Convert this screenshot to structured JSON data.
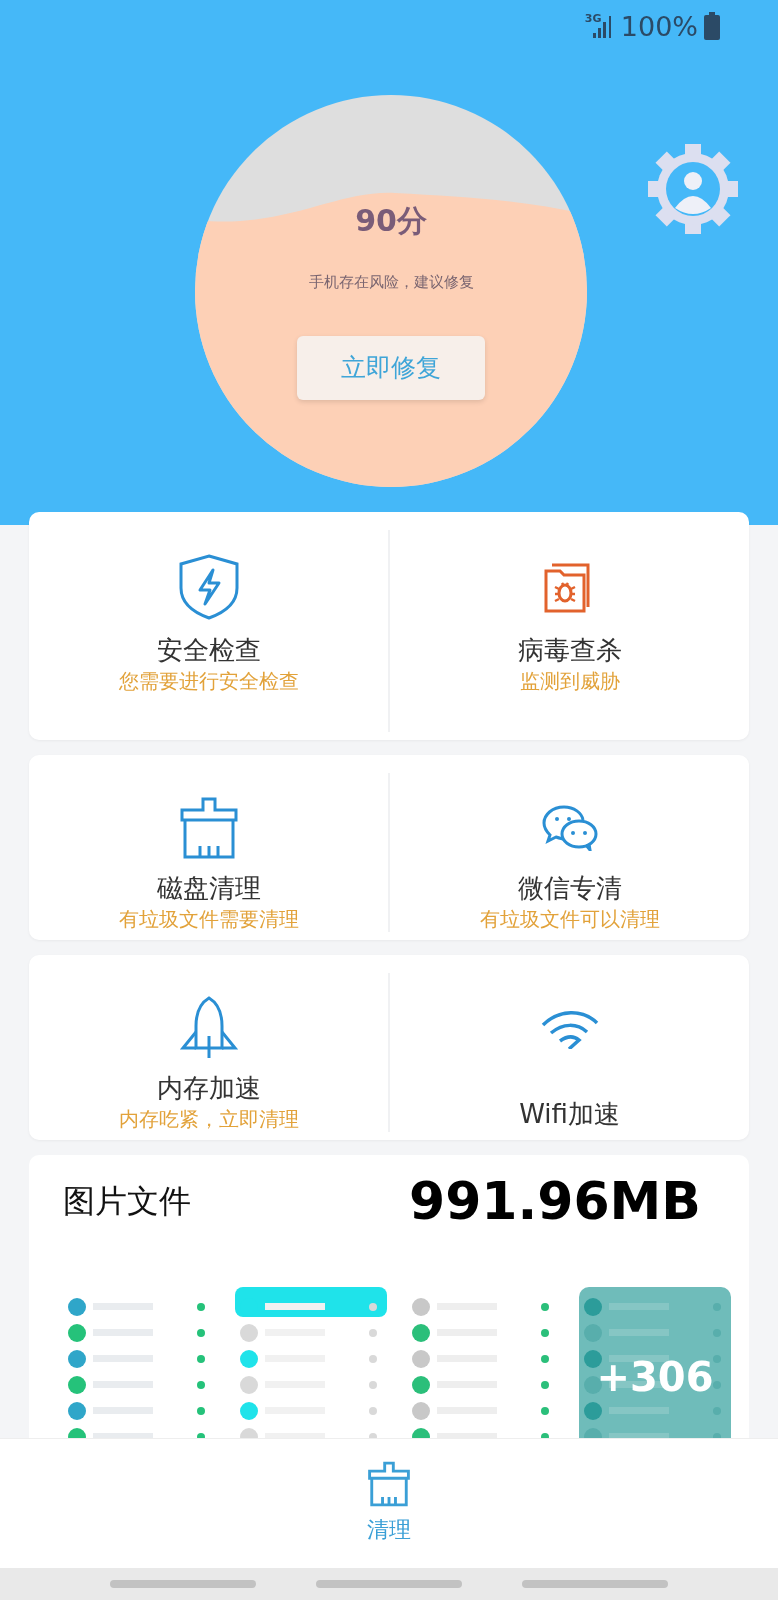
{
  "status_bar": {
    "network": "3G",
    "battery": "100%"
  },
  "gauge": {
    "score": "90分",
    "message": "手机存在风险，建议修复",
    "button": "立即修复"
  },
  "features": [
    {
      "title": "安全检查",
      "subtitle": "您需要进行安全检查"
    },
    {
      "title": "病毒查杀",
      "subtitle": "监测到威胁"
    },
    {
      "title": "磁盘清理",
      "subtitle": "有垃圾文件需要清理"
    },
    {
      "title": "微信专清",
      "subtitle": "有垃圾文件可以清理"
    },
    {
      "title": "内存加速",
      "subtitle": "内存吃紧，立即清理"
    },
    {
      "title": "Wifi加速"
    }
  ],
  "photos": {
    "title": "图片文件",
    "size": "991.96MB",
    "thumbnails": [
      {
        "kind": "picture"
      },
      {
        "kind": "picture"
      },
      {
        "kind": "picture"
      },
      {
        "kind": "picture",
        "more": "+306"
      }
    ]
  },
  "tabs": [
    {
      "label": "清理",
      "selected": true
    }
  ]
}
